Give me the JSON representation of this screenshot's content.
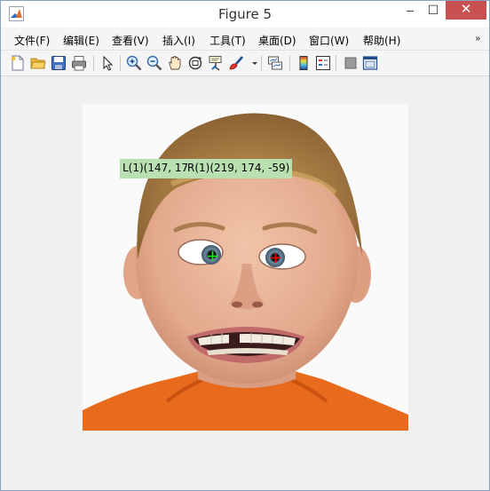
{
  "window": {
    "title": "Figure 5",
    "controls": {
      "minimize": "–",
      "maximize": "☐",
      "close": "✕"
    }
  },
  "menubar": {
    "items": [
      "文件(F)",
      "编辑(E)",
      "查看(V)",
      "插入(I)",
      "工具(T)",
      "桌面(D)",
      "窗口(W)",
      "帮助(H)"
    ],
    "overflow_icon": "double-chevron-icon"
  },
  "toolbar": {
    "icons": [
      "new-figure-icon",
      "open-file-icon",
      "save-icon",
      "print-icon",
      "select-arrow-icon",
      "zoom-in-icon",
      "zoom-out-icon",
      "pan-hand-icon",
      "rotate-3d-icon",
      "data-cursor-icon",
      "brush-icon",
      "brush-dropdown-icon",
      "link-plot-icon",
      "colorbar-icon",
      "legend-icon",
      "hide-plot-tools-icon",
      "show-plot-tools-icon"
    ]
  },
  "figure": {
    "datatip_left": "L(1)(147, 17",
    "datatip_right": "R(1)(219, 174, -59)",
    "left_marker_color": "#00ff00",
    "right_marker_color": "#ff0000"
  }
}
